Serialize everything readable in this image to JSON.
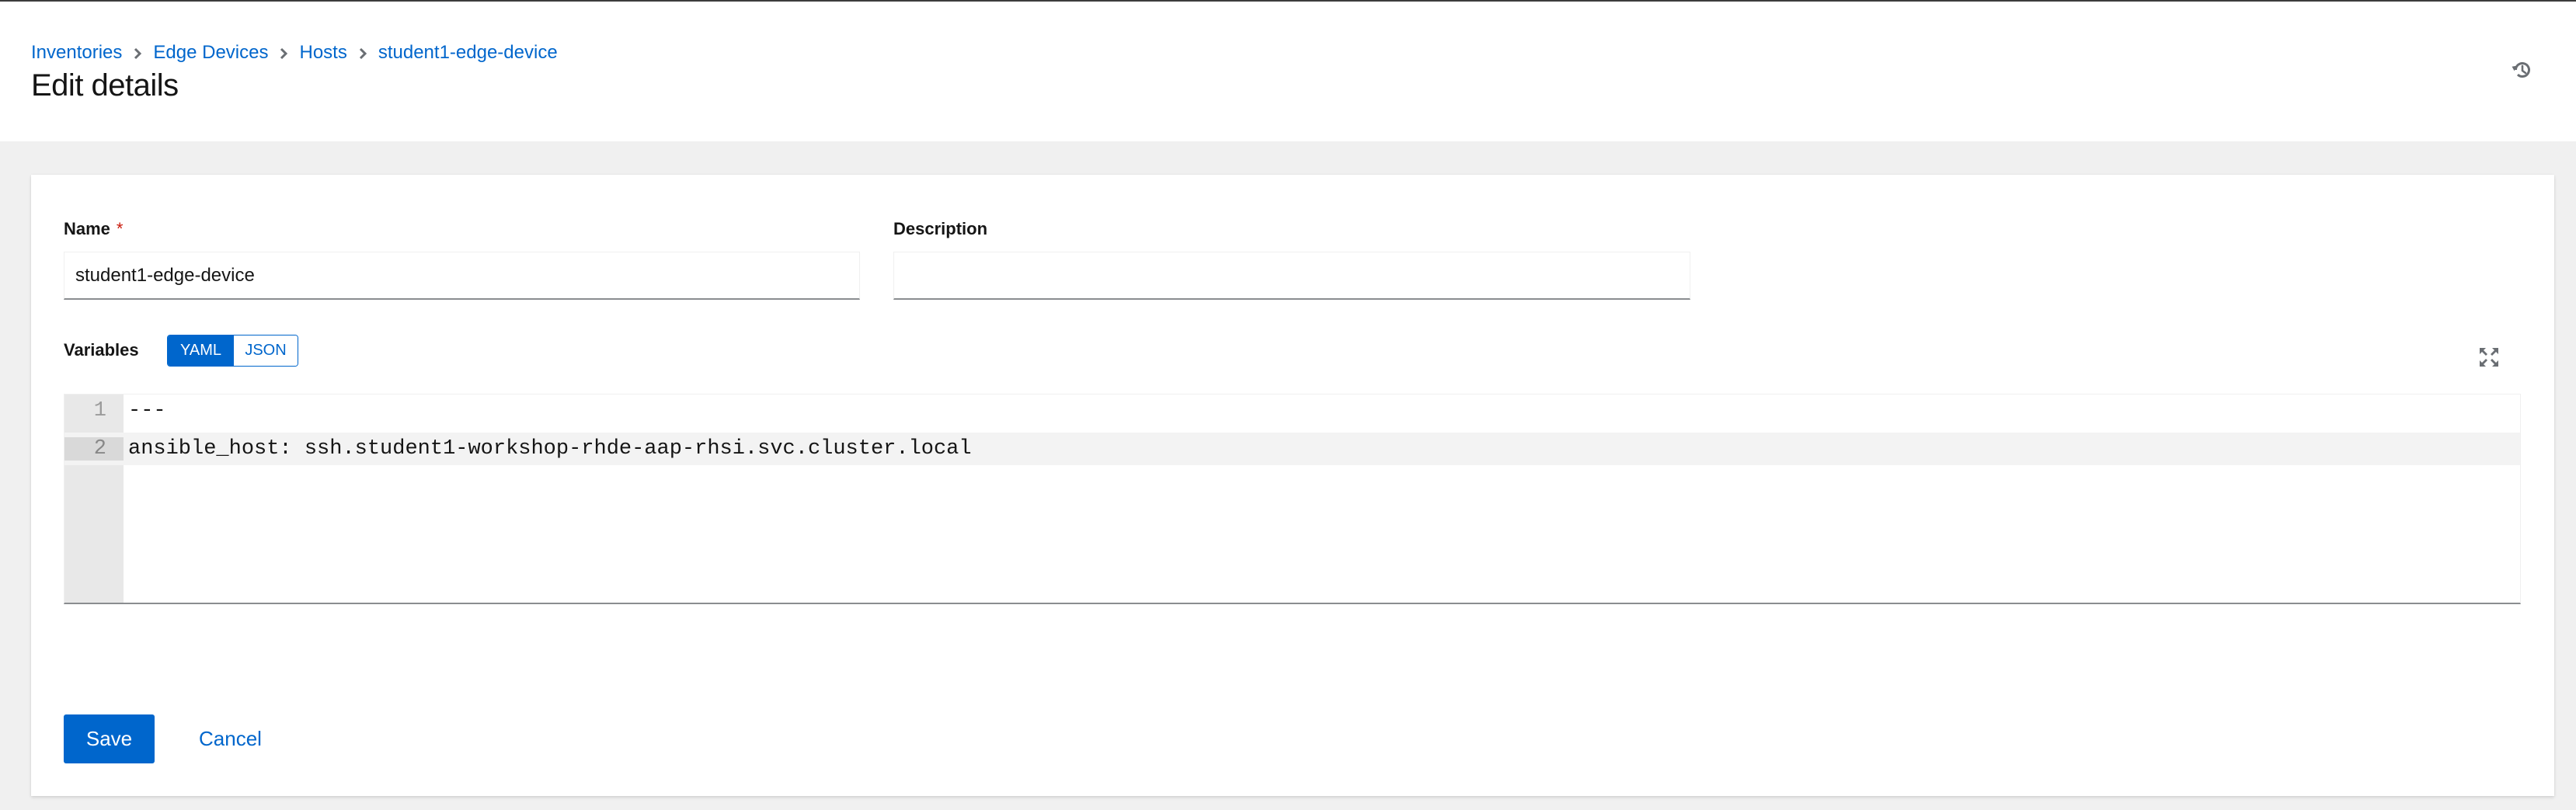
{
  "header": {
    "breadcrumb": [
      {
        "label": "Inventories"
      },
      {
        "label": "Edge Devices"
      },
      {
        "label": "Hosts"
      },
      {
        "label": "student1-edge-device"
      }
    ],
    "title": "Edit details",
    "history_icon": "history-icon"
  },
  "form": {
    "name": {
      "label": "Name",
      "required_mark": "*",
      "value": "student1-edge-device"
    },
    "description": {
      "label": "Description",
      "value": ""
    },
    "variables": {
      "label": "Variables",
      "toggle": {
        "options": [
          "YAML",
          "JSON"
        ],
        "selected": "YAML"
      },
      "expand_icon": "expand-icon",
      "lines": [
        {
          "number": "1",
          "text": "---"
        },
        {
          "number": "2",
          "text": "ansible_host: ssh.student1-workshop-rhde-aap-rhsi.svc.cluster.local",
          "active": true
        }
      ]
    },
    "actions": {
      "save_label": "Save",
      "cancel_label": "Cancel"
    }
  },
  "colors": {
    "accent": "#0066cc",
    "required": "#c9190b",
    "page_background": "#f0f0f0"
  }
}
